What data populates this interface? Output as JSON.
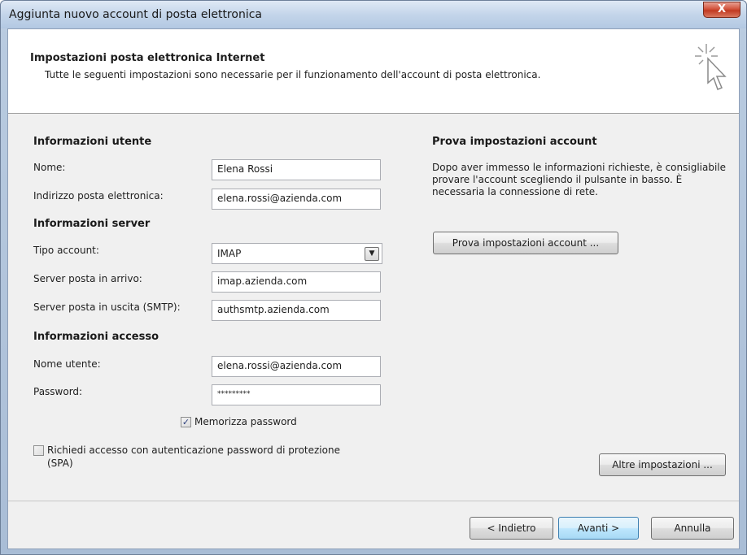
{
  "window": {
    "title": "Aggiunta nuovo account di posta elettronica",
    "close_glyph": "X"
  },
  "header": {
    "title": "Impostazioni posta elettronica Internet",
    "subtitle": "Tutte le seguenti impostazioni sono necessarie per il funzionamento dell'account di posta elettronica.",
    "icon": "cursor-sparkle-icon"
  },
  "user_info": {
    "title": "Informazioni utente",
    "name_label": "Nome:",
    "name_value": "Elena Rossi",
    "email_label": "Indirizzo posta elettronica:",
    "email_value": "elena.rossi@azienda.com"
  },
  "server_info": {
    "title": "Informazioni server",
    "account_type_label": "Tipo account:",
    "account_type_value": "IMAP",
    "incoming_label": "Server posta in arrivo:",
    "incoming_value": "imap.azienda.com",
    "outgoing_label": "Server posta in uscita (SMTP):",
    "outgoing_value": "authsmtp.azienda.com"
  },
  "login_info": {
    "title": "Informazioni accesso",
    "username_label": "Nome utente:",
    "username_value": "elena.rossi@azienda.com",
    "password_label": "Password:",
    "password_value": "*********",
    "remember_label": "Memorizza password",
    "remember_checked": true,
    "spa_label_line1": "Richiedi accesso con autenticazione password di protezione",
    "spa_label_line2": "(SPA)",
    "spa_checked": false
  },
  "test": {
    "title": "Prova impostazioni account",
    "description": "Dopo aver immesso le informazioni richieste, è consigliabile provare l'account scegliendo il pulsante in basso. È necessaria la connessione di rete.",
    "button": "Prova impostazioni account ...",
    "more_button": "Altre impostazioni ..."
  },
  "footer": {
    "back": "< Indietro",
    "next": "Avanti >",
    "cancel": "Annulla"
  },
  "colors": {
    "title_bar": "#c4d5ea",
    "close_button": "#c13a22",
    "primary_button": "#bee6fd"
  }
}
